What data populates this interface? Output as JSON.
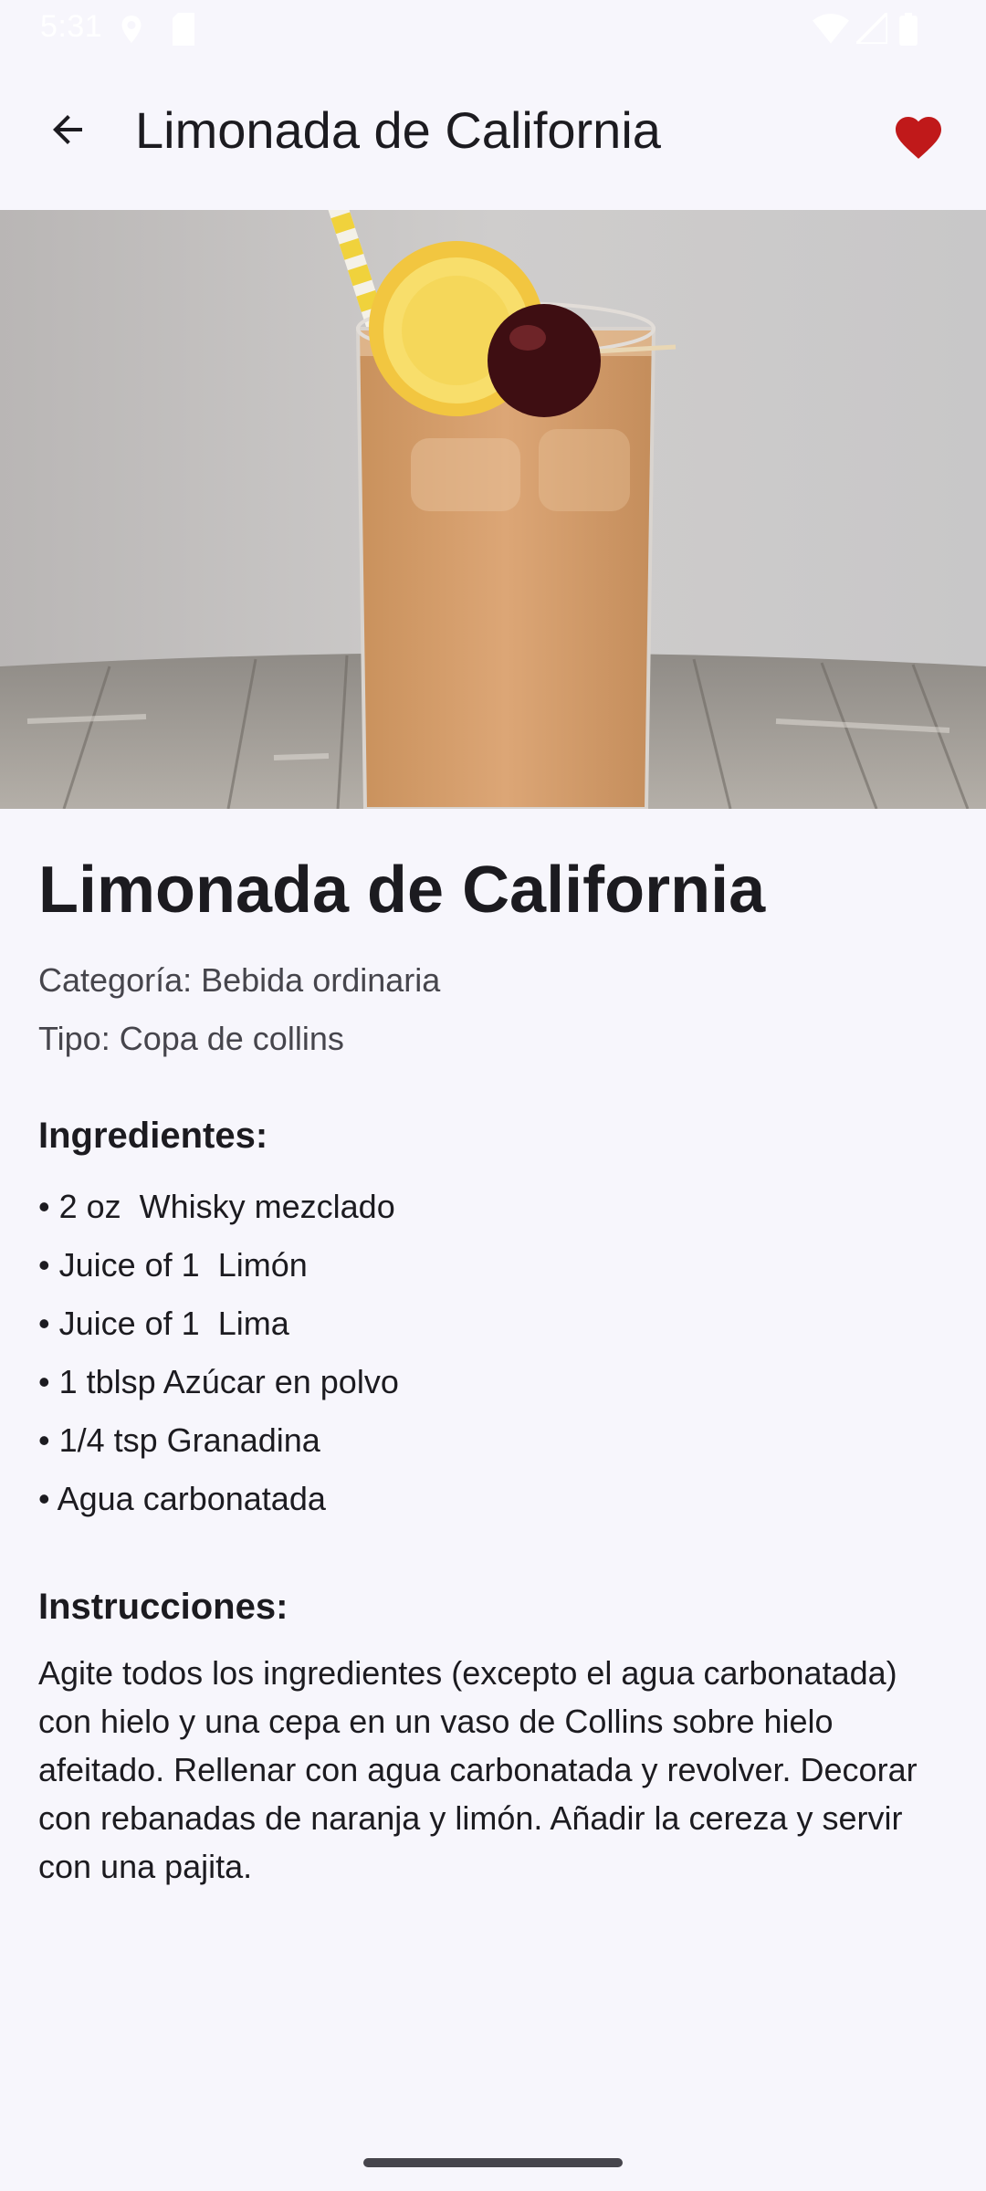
{
  "status_bar": {
    "time": "5:31",
    "icons": [
      "location-icon",
      "sd-card-icon",
      "wifi-icon",
      "signal-icon",
      "battery-icon"
    ]
  },
  "app_bar": {
    "title": "Limonada de California",
    "back_icon": "arrow-back-icon",
    "favorite_icon": "heart-icon",
    "favorite_color": "#c0191a"
  },
  "hero_image": {
    "description_icon": "cocktail-photo"
  },
  "drink": {
    "title": "Limonada de California",
    "category": "Categoría: Bebida ordinaria",
    "glass": "Tipo: Copa de collins",
    "ingredients_heading": "Ingredientes:",
    "ingredients": [
      "• 2 oz  Whisky mezclado",
      "• Juice of 1  Limón",
      "• Juice of 1  Lima",
      "• 1 tblsp Azúcar en polvo",
      "• 1/4 tsp Granadina",
      "• Agua carbonatada"
    ],
    "instructions_heading": "Instrucciones:",
    "instructions": "Agite todos los ingredientes (excepto el agua carbonatada) con hielo y una cepa en un vaso de Collins sobre hielo afeitado. Rellenar con agua carbonatada y revolver. Decorar con rebanadas de naranja y limón. Añadir la cereza y servir con una pajita."
  },
  "colors": {
    "background": "#f7f6fc",
    "text": "#1c1b20",
    "secondary_text": "#46454c",
    "accent_heart": "#c0191a"
  }
}
